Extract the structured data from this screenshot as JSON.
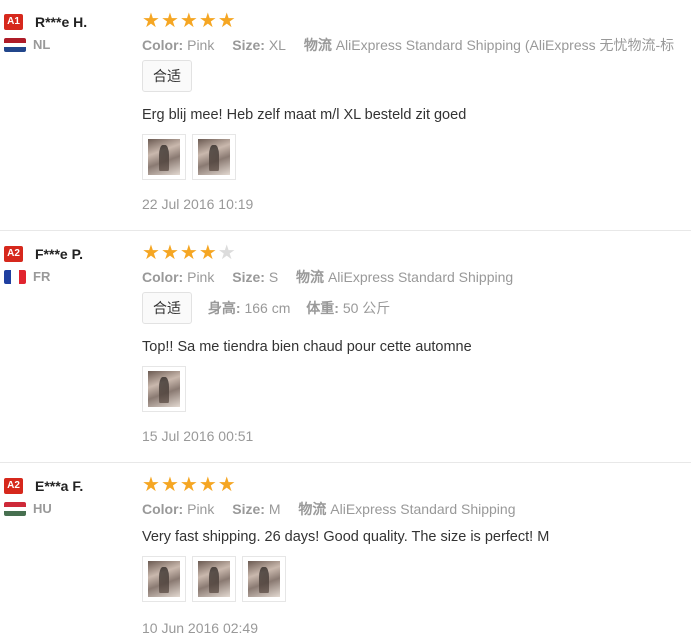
{
  "reviews": [
    {
      "badge": "A1",
      "name": "R***e H.",
      "country": "NL",
      "rating": 5,
      "color_label": "Color:",
      "color": "Pink",
      "size_label": "Size:",
      "size": "XL",
      "logistics_label": "物流",
      "logistics": "AliExpress Standard Shipping (AliExpress 无忧物流-标",
      "tag": "合适",
      "text": "Erg blij mee! Heb zelf maat m/l XL besteld zit goed",
      "images": 2,
      "date": "22 Jul 2016 10:19"
    },
    {
      "badge": "A2",
      "name": "F***e P.",
      "country": "FR",
      "rating": 4,
      "color_label": "Color:",
      "color": "Pink",
      "size_label": "Size:",
      "size": "S",
      "logistics_label": "物流",
      "logistics": "AliExpress Standard Shipping",
      "tag": "合适",
      "height_label": "身高:",
      "height": "166 cm",
      "weight_label": "体重:",
      "weight": "50 公斤",
      "text": "Top!! Sa me tiendra bien chaud pour cette automne",
      "images": 1,
      "date": "15 Jul 2016 00:51"
    },
    {
      "badge": "A2",
      "name": "E***a F.",
      "country": "HU",
      "rating": 5,
      "color_label": "Color:",
      "color": "Pink",
      "size_label": "Size:",
      "size": "M",
      "logistics_label": "物流",
      "logistics": "AliExpress Standard Shipping",
      "text": "Very fast shipping. 26 days! Good quality. The size is perfect! M",
      "images": 3,
      "date": "10 Jun 2016 02:49"
    }
  ],
  "colors": {
    "badge": "#d6281c",
    "star": "#f5a623",
    "star_empty": "#dcdcdc",
    "muted_text": "#999999"
  }
}
